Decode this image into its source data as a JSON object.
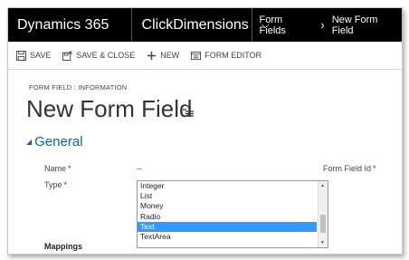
{
  "nav": {
    "brand": "Dynamics 365",
    "area": "ClickDimensions",
    "breadcrumb": [
      "Form Fields",
      "New Form Field"
    ]
  },
  "commands": [
    {
      "label": "SAVE",
      "icon": "save-icon"
    },
    {
      "label": "SAVE & CLOSE",
      "icon": "save-close-icon"
    },
    {
      "label": "NEW",
      "icon": "plus-icon"
    },
    {
      "label": "FORM EDITOR",
      "icon": "form-editor-icon"
    }
  ],
  "header": {
    "form_label": "FORM FIELD : INFORMATION",
    "title": "New Form Field"
  },
  "section": {
    "title": "General"
  },
  "fields": {
    "name": {
      "label": "Name",
      "value": "--"
    },
    "type": {
      "label": "Type",
      "options": [
        "Integer",
        "List",
        "Money",
        "Radio",
        "Text",
        "TextArea"
      ],
      "selected": "Text"
    },
    "form_field_id": {
      "label": "Form Field Id"
    }
  },
  "mappings": {
    "title": "Mappings"
  },
  "colors": {
    "nav_bg": "#000000",
    "accent": "#1160b7",
    "selection": "#3399ff",
    "required": "#dd0000"
  }
}
